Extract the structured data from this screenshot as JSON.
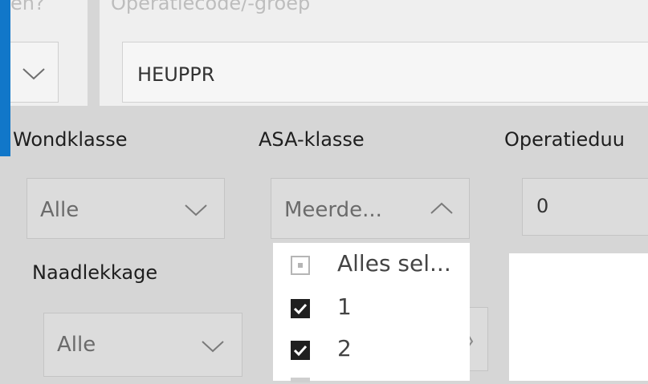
{
  "header": {
    "left_label": "en?",
    "operation_label": "Operatiecode/-groep",
    "operation_value": "HEUPPR"
  },
  "filters": {
    "wondklasse": {
      "label": "Wondklasse",
      "value": "Alle"
    },
    "asa": {
      "label": "ASA-klasse",
      "value": "Meerde..."
    },
    "operatieduur": {
      "label": "Operatieduu",
      "value": "0"
    },
    "naadlekkage": {
      "label": "Naadlekkage",
      "value": "Alle"
    }
  },
  "asa_list": {
    "items": [
      {
        "label": "Alles sel...",
        "state": "partial"
      },
      {
        "label": "1",
        "state": "checked"
      },
      {
        "label": "2",
        "state": "checked"
      }
    ]
  },
  "colors": {
    "accent": "#1177c9"
  }
}
